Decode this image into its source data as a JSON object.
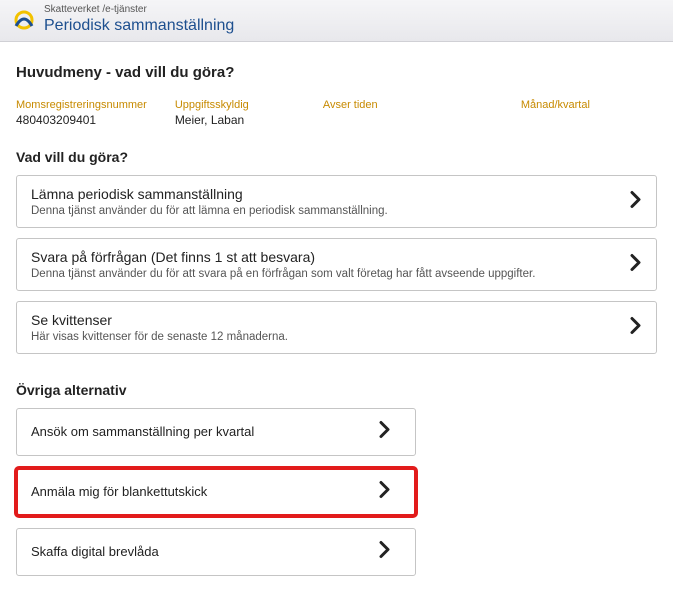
{
  "header": {
    "small": "Skatteverket /e-tjänster",
    "title": "Periodisk sammanställning"
  },
  "page_title": "Huvudmeny - vad vill du göra?",
  "info": {
    "vat_label": "Momsregistreringsnummer",
    "vat_value": "480403209401",
    "reporter_label": "Uppgiftsskyldig",
    "reporter_value": "Meier, Laban",
    "period_label": "Avser tiden",
    "period_value": "",
    "month_label": "Månad/kvartal",
    "month_value": ""
  },
  "section1_title": "Vad vill du göra?",
  "cards": [
    {
      "title": "Lämna periodisk sammanställning",
      "desc": "Denna tjänst använder du för att lämna en periodisk sammanställning."
    },
    {
      "title": "Svara på förfrågan (Det finns 1 st att besvara)",
      "desc": "Denna tjänst använder du för att svara på en förfrågan som valt företag har fått avseende uppgifter."
    },
    {
      "title": "Se kvittenser",
      "desc": "Här visas kvittenser för de senaste 12 månaderna."
    }
  ],
  "section2_title": "Övriga alternativ",
  "small_cards": [
    {
      "title": "Ansök om sammanställning per kvartal"
    },
    {
      "title": "Anmäla mig för blankettutskick"
    },
    {
      "title": "Skaffa digital brevlåda"
    }
  ]
}
